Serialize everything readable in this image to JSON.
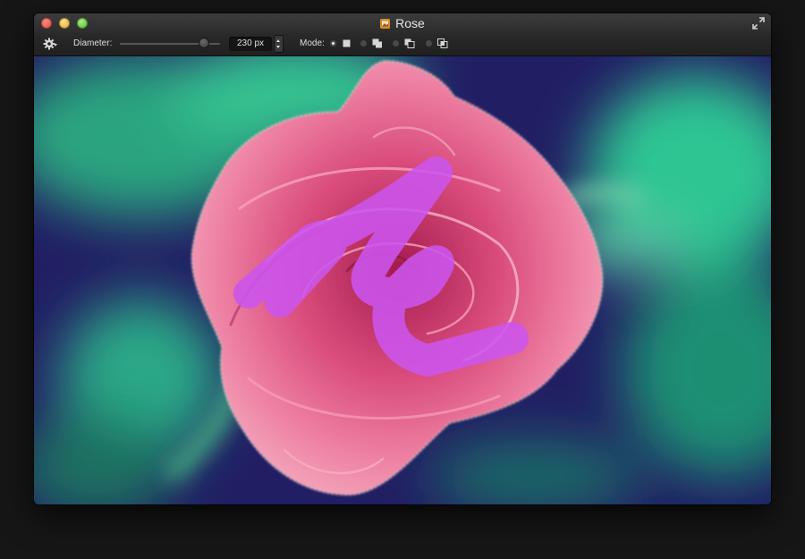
{
  "window": {
    "title": "Rose"
  },
  "toolbar": {
    "diameter_label": "Diameter:",
    "diameter_value": "230 px",
    "mode_label": "Mode:",
    "modes": [
      {
        "icon": "replace-selection-icon",
        "selected": true
      },
      {
        "icon": "add-to-selection-icon",
        "selected": false
      },
      {
        "icon": "subtract-from-selection-icon",
        "selected": false
      },
      {
        "icon": "intersect-selection-icon",
        "selected": false
      }
    ]
  },
  "colors": {
    "brush_overlay": "#cc55ee",
    "rose": "#e8668e",
    "background_green": "#2ec08d",
    "background_navy": "#221e63"
  }
}
